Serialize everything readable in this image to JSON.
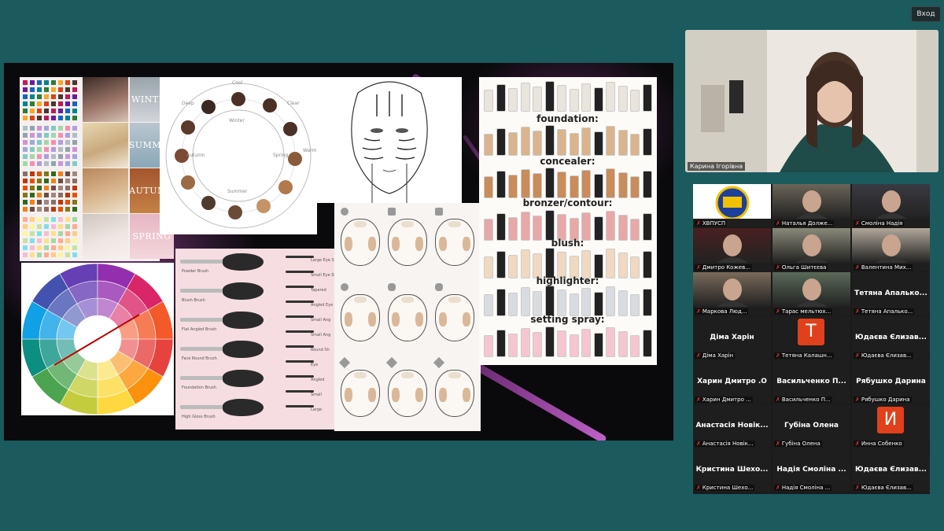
{
  "top_button": "Вход",
  "slide": {
    "seasons": [
      "WINTER",
      "SUMMER",
      "AUTUMN",
      "SPRING"
    ],
    "wheel_labels": [
      "Cool",
      "Winter",
      "Warm",
      "Spring",
      "Summer",
      "Autumn",
      "Deep",
      "Clear"
    ],
    "product_sections": [
      "foundation:",
      "concealer:",
      "bronzer/contour:",
      "blush:",
      "highlighter:",
      "setting spray:"
    ],
    "brushes_left": [
      "Powder Brush",
      "Blush Brush",
      "Flat Angled Brush",
      "Face Round Brush",
      "Foundation Brush",
      "High Gloss Brush"
    ],
    "brushes_right": [
      "Large Eye Sh",
      "Small Eye Sh",
      "Tapered",
      "Angled Eye",
      "Small Ang",
      "Small Ang",
      "Round Sh",
      "Eye",
      "Angled",
      "Small",
      "Large"
    ]
  },
  "presenter": {
    "name": "Карина Ігорівна"
  },
  "participants": [
    {
      "tile_title": "",
      "name": "ХВПУСП",
      "kind": "logo"
    },
    {
      "tile_title": "",
      "name": "Наталья Долже...",
      "kind": "photo"
    },
    {
      "tile_title": "",
      "name": "Смоліна Надія",
      "kind": "photo"
    },
    {
      "tile_title": "",
      "name": "Дмитро Кожев...",
      "kind": "photo"
    },
    {
      "tile_title": "",
      "name": "Ольга Шитєєва",
      "kind": "photo"
    },
    {
      "tile_title": "",
      "name": "Валентина Мих...",
      "kind": "photo"
    },
    {
      "tile_title": "",
      "name": "Маркова Люд...",
      "kind": "photo"
    },
    {
      "tile_title": "",
      "name": "Тарас мельтюх...",
      "kind": "photo"
    },
    {
      "tile_title": "Тетяна Апалько...",
      "name": "Тетяна Апалько...",
      "kind": "text"
    },
    {
      "tile_title": "Діма Харін",
      "name": "Діма Харін",
      "kind": "text"
    },
    {
      "tile_title": "",
      "name": "Тетяна Калашн...",
      "kind": "letter",
      "letter": "Т"
    },
    {
      "tile_title": "Юдаєва Єлизав...",
      "name": "Юдаєва Єлизав...",
      "kind": "text"
    },
    {
      "tile_title": "Харин Дмитро .О",
      "name": "Харин Дмитро ...",
      "kind": "text"
    },
    {
      "tile_title": "Васильченко П...",
      "name": "Васильченко П...",
      "kind": "text"
    },
    {
      "tile_title": "Рябушко Дарина",
      "name": "Рябушко Дарина",
      "kind": "text"
    },
    {
      "tile_title": "Анастасія Новік...",
      "name": "Анастасія Новік...",
      "kind": "text"
    },
    {
      "tile_title": "Губіна Олена",
      "name": "Губіна Олена",
      "kind": "text"
    },
    {
      "tile_title": "",
      "name": "Инна Собенко",
      "kind": "letter",
      "letter": "И"
    },
    {
      "tile_title": "Кристина Шехо...",
      "name": "Кристина Шехо...",
      "kind": "text"
    },
    {
      "tile_title": "Надія Смоліна ...",
      "name": "Надія Смоліна ...",
      "kind": "text"
    },
    {
      "tile_title": "Юдаєва Єлизав...",
      "name": "Юдаєва Єлизав...",
      "kind": "text"
    }
  ],
  "colors": {
    "background": "#1b5a5d",
    "mute_icon": "#e33333",
    "avatar": "#e0401b"
  }
}
